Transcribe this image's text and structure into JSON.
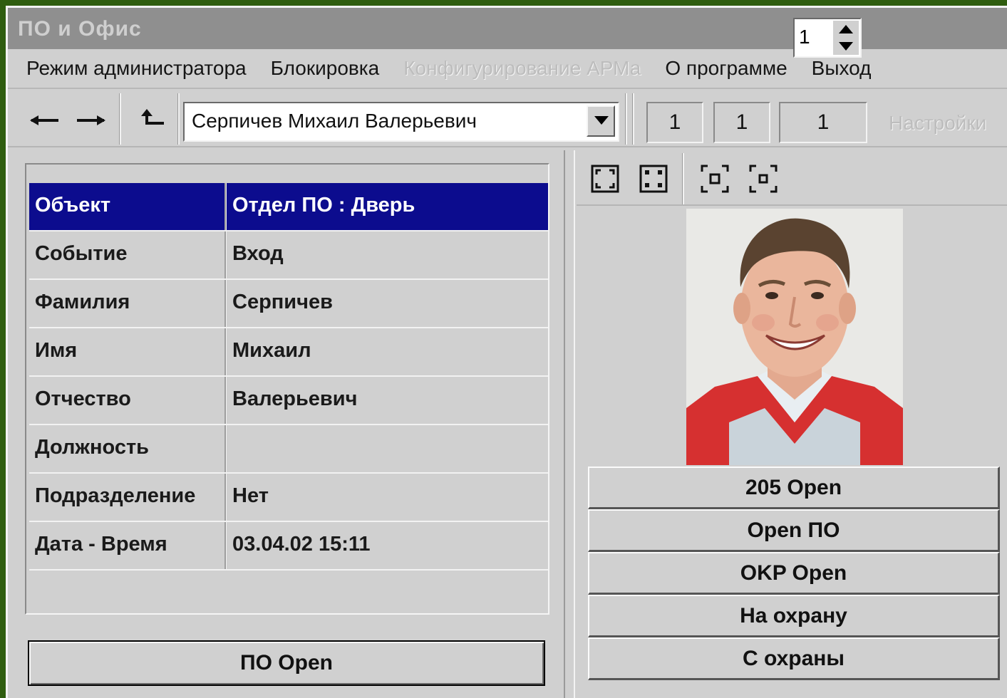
{
  "window": {
    "title": "ПО и Офис"
  },
  "menu": [
    {
      "label": "Режим администратора",
      "disabled": false
    },
    {
      "label": "Блокировка",
      "disabled": false
    },
    {
      "label": "Конфигурирование АРМа",
      "disabled": true
    },
    {
      "label": "О программе",
      "disabled": false
    },
    {
      "label": "Выход",
      "disabled": false
    }
  ],
  "toolbar": {
    "back_icon": "arrow-left-icon",
    "forward_icon": "arrow-right-icon",
    "up_icon": "arrow-up-left-icon",
    "person_select_value": "Серпичев Михаил Валерьевич",
    "counters": [
      "1",
      "1",
      "1"
    ],
    "settings_label": "Настройки"
  },
  "details": {
    "rows": [
      {
        "key": "Объект",
        "value": "Отдел ПО : Дверь",
        "selected": true
      },
      {
        "key": "Событие",
        "value": "Вход"
      },
      {
        "key": "Фамилия",
        "value": "Серпичев"
      },
      {
        "key": "Имя",
        "value": "Михаил"
      },
      {
        "key": "Отчество",
        "value": "Валерьевич"
      },
      {
        "key": "Должность",
        "value": ""
      },
      {
        "key": "Подразделение",
        "value": "Нет"
      },
      {
        "key": "Дата - Время",
        "value": "03.04.02 15:11"
      }
    ],
    "action_button_label": "ПО Open"
  },
  "viewer": {
    "zoom_value": "1",
    "icons": [
      "fit-window-icon",
      "full-screen-icon",
      "zoom-in-icon",
      "zoom-out-icon"
    ]
  },
  "commands": [
    {
      "label": "205 Open"
    },
    {
      "label": "Open ПО"
    },
    {
      "label": "OKP Open"
    },
    {
      "label": "На охрану"
    },
    {
      "label": "С охраны"
    }
  ],
  "colors": {
    "selection": "#0c0c8e",
    "desktop": "#2f5d0f"
  }
}
